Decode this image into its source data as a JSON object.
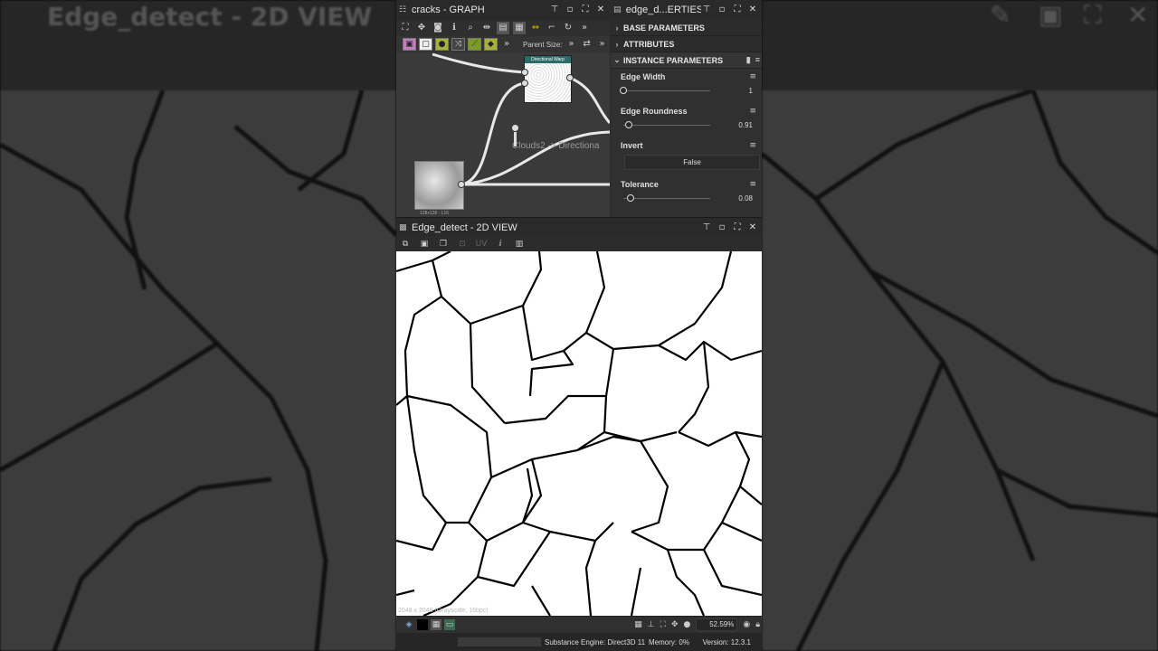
{
  "background": {
    "title": "Edge_detect - 2D VIEW"
  },
  "graph_panel": {
    "title": "cracks - GRAPH",
    "parent_size_label": "Parent Size:",
    "node_directional_warp": "Directional Warp",
    "node_clouds_caption": "Clouds2 -> Directiona",
    "noise_thumb_caption": "128x128 - L16"
  },
  "properties_panel": {
    "title": "edge_d...ERTIES",
    "sections": {
      "base": "BASE PARAMETERS",
      "attributes": "ATTRIBUTES",
      "instance": "INSTANCE PARAMETERS"
    },
    "params": [
      {
        "label": "Edge Width",
        "value": "1",
        "level": 0.0
      },
      {
        "label": "Edge Roundness",
        "value": "0.91",
        "level": 0.06
      },
      {
        "label": "Invert",
        "value": "False"
      },
      {
        "label": "Tolerance",
        "value": "0.08",
        "level": 0.08
      }
    ]
  },
  "view_panel": {
    "title": "Edge_detect - 2D VIEW",
    "uv_label": "UV",
    "resolution_info": "2048 x 2048 (Grayscale, 16bpc)",
    "zoom": "52.59%"
  },
  "status_bar": {
    "engine": "Substance Engine: Direct3D 11",
    "memory": "Memory: 0%",
    "version": "Version: 12.3.1"
  },
  "icons": [
    "graph-icon",
    "pin-icon",
    "restore-icon",
    "maximize-icon",
    "close-icon",
    "search-icon",
    "camera-icon",
    "info-icon",
    "chevron-right-icon",
    "histogram-icon",
    "grid-icon",
    "lock-icon",
    "save-icon",
    "copy-icon"
  ],
  "colors": {
    "panel_bg": "#2b2b2b",
    "node_header": "#2d6a6a",
    "swatch_green": "#7a9a2a"
  }
}
